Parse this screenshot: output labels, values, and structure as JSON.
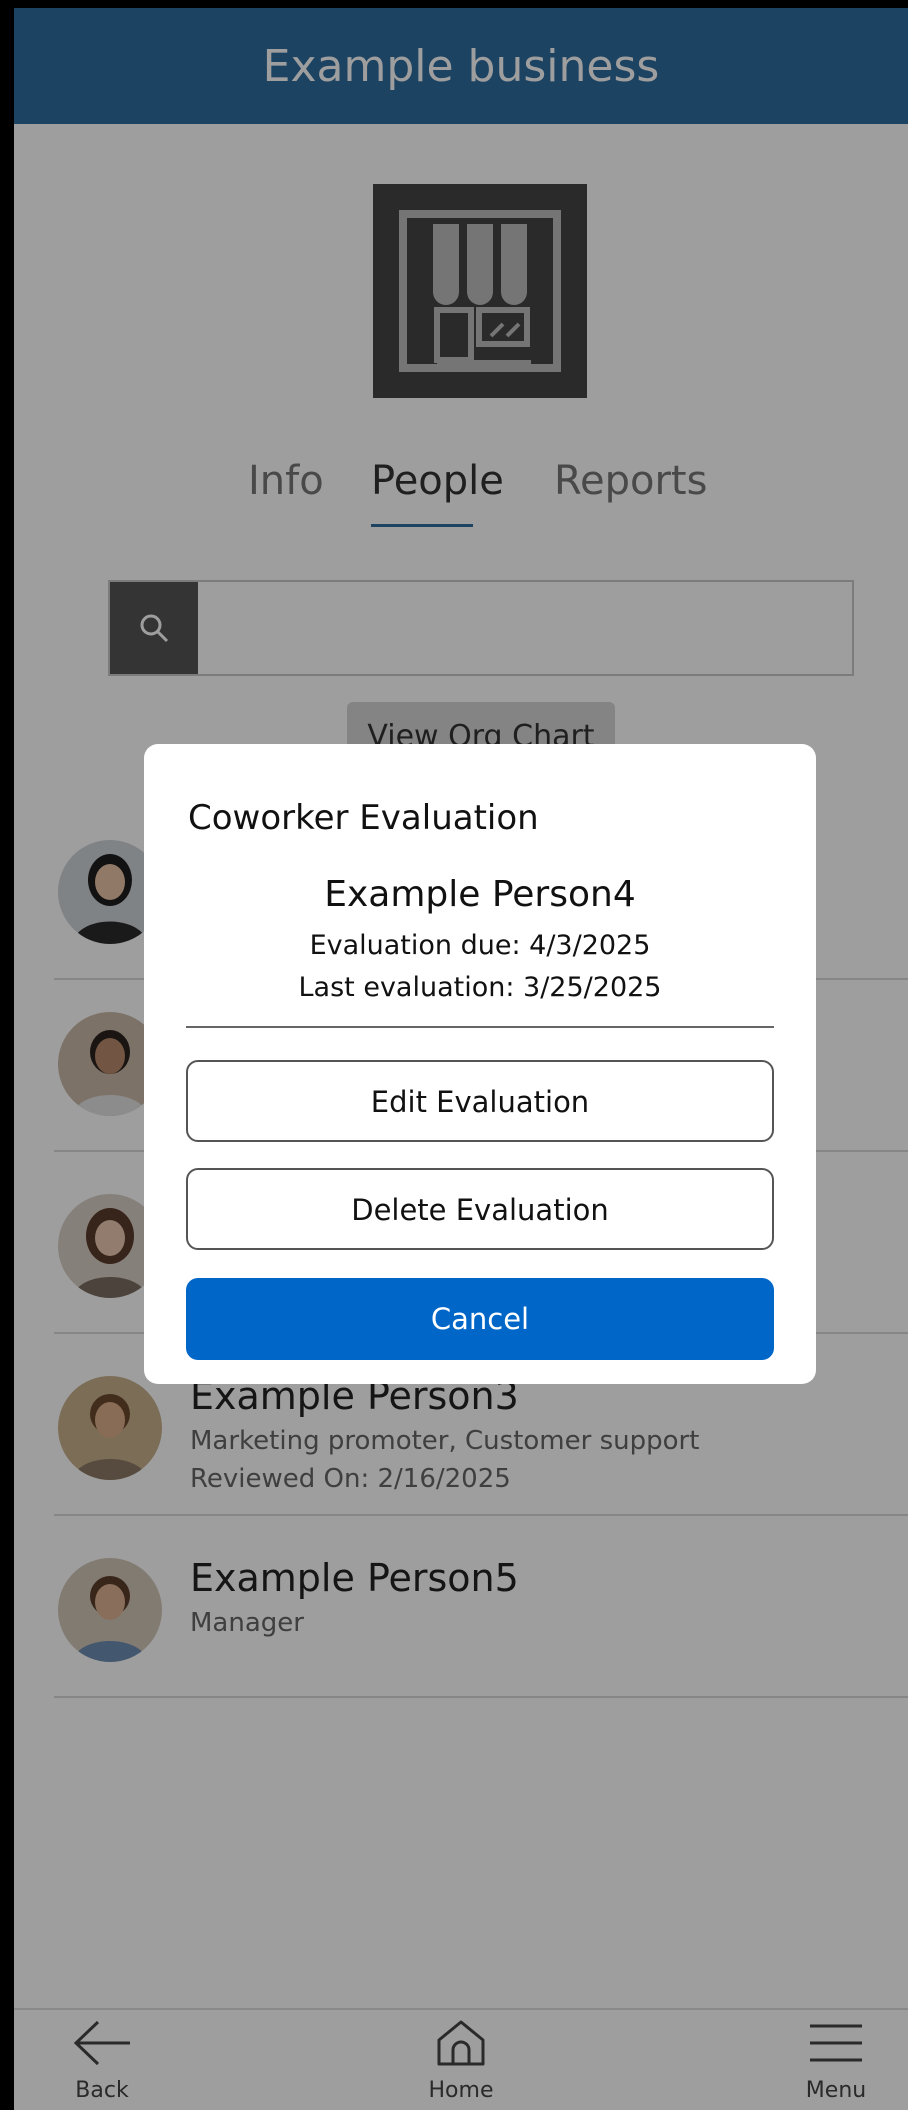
{
  "header": {
    "title": "Example business"
  },
  "logo": {
    "icon": "storefront-icon"
  },
  "tabs": [
    {
      "label": "Info",
      "active": false
    },
    {
      "label": "People",
      "active": true
    },
    {
      "label": "Reports",
      "active": false
    }
  ],
  "search": {
    "icon": "search-icon",
    "placeholder": ""
  },
  "org_chart_button": {
    "label": "View Org Chart"
  },
  "people": [
    {
      "name": "",
      "role": "",
      "reviewed": ""
    },
    {
      "name": "",
      "role": "",
      "reviewed": ""
    },
    {
      "name": "",
      "role": "",
      "reviewed": ""
    },
    {
      "name": "Example Person3",
      "role": "Marketing promoter, Customer support",
      "reviewed": "Reviewed On: 2/16/2025"
    },
    {
      "name": "Example Person5",
      "role": "Manager",
      "reviewed": ""
    }
  ],
  "bottom_nav": {
    "back": {
      "label": "Back",
      "icon": "arrow-left-icon"
    },
    "home": {
      "label": "Home",
      "icon": "home-icon"
    },
    "menu": {
      "label": "Menu",
      "icon": "hamburger-icon"
    }
  },
  "modal": {
    "title": "Coworker Evaluation",
    "person": "Example Person4",
    "evaluation_due": "Evaluation due: 4/3/2025",
    "last_evaluation": "Last evaluation: 3/25/2025",
    "edit_label": "Edit Evaluation",
    "delete_label": "Delete Evaluation",
    "cancel_label": "Cancel"
  },
  "colors": {
    "header": "#2f6c9f",
    "primary_button": "#0067c9",
    "overlay": "rgba(0,0,0,0.38)"
  }
}
